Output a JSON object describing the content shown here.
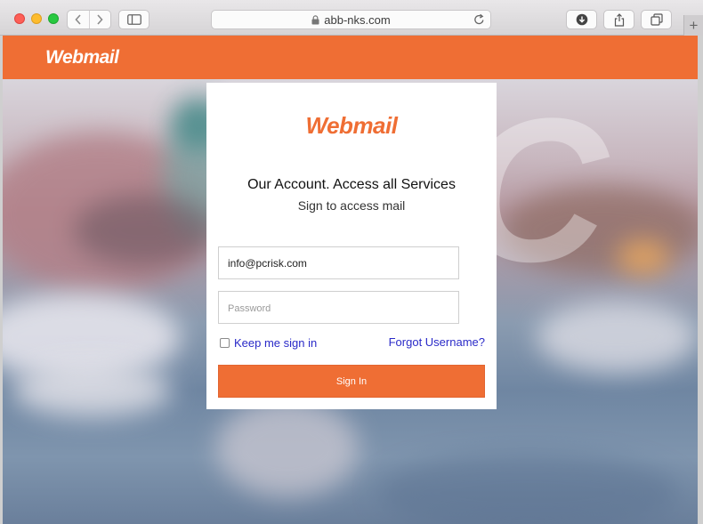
{
  "browser": {
    "url": "abb-nks.com",
    "new_tab_label": "+"
  },
  "header": {
    "logo_text": "Webmail"
  },
  "login": {
    "logo_text": "Webmail",
    "heading": "Our Account. Access all Services",
    "subheading": "Sign to access mail",
    "email_value": "info@pcrisk.com",
    "password_placeholder": "Password",
    "remember_label": "Keep me sign in",
    "forgot_label": "Forgot Username?",
    "signin_label": "Sign In"
  },
  "colors": {
    "accent": "#ef6e34",
    "link": "#2a2ac8"
  }
}
